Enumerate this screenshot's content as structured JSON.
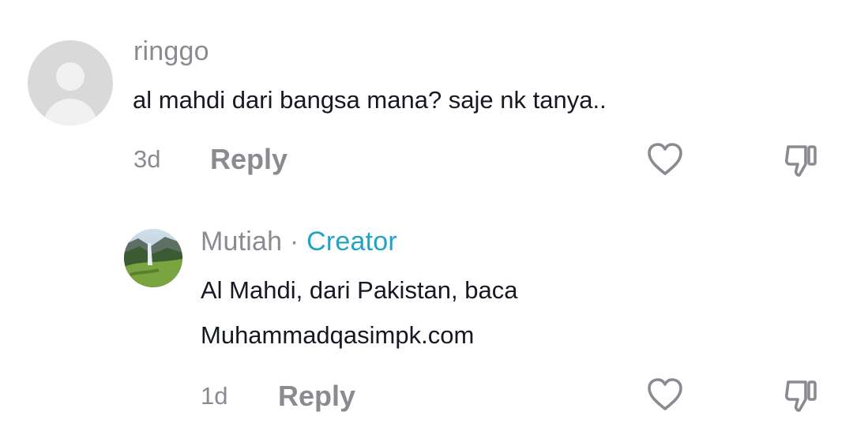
{
  "comments": [
    {
      "username": "ringgo",
      "text": "al mahdi dari bangsa mana? saje nk tanya..",
      "time": "3d",
      "reply_label": "Reply",
      "avatar": "default-user-avatar-icon"
    }
  ],
  "replies": [
    {
      "username": "Mutiah",
      "separator": "·",
      "badge": "Creator",
      "text_line1": "Al Mahdi, dari Pakistan, baca",
      "text_line2": "Muhammadqasimpk.com",
      "time": "1d",
      "reply_label": "Reply",
      "avatar": "landscape-waterfall-photo"
    }
  ],
  "icons": {
    "like": "heart-outline-icon",
    "dislike": "thumbs-down-outline-icon"
  },
  "colors": {
    "text_primary": "#161823",
    "text_secondary": "#8a8b91",
    "creator_accent": "#20a4c6",
    "avatar_placeholder": "#d9d9d9"
  }
}
